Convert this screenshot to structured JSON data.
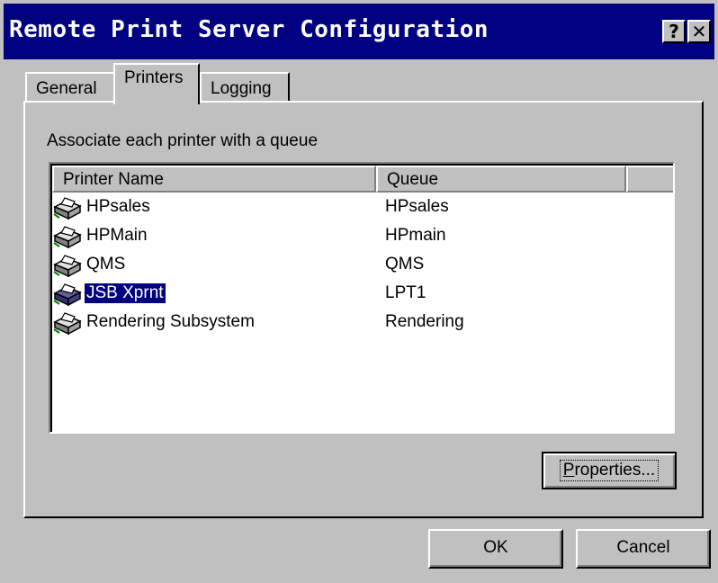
{
  "window": {
    "title": "Remote Print Server Configuration",
    "help_glyph": "?",
    "close_glyph": "✕"
  },
  "tabs": [
    {
      "label": "General",
      "active": false
    },
    {
      "label": "Printers",
      "active": true
    },
    {
      "label": "Logging",
      "active": false
    }
  ],
  "panel": {
    "description": "Associate each printer with a queue",
    "columns": [
      "Printer Name",
      "Queue"
    ],
    "rows": [
      {
        "name": "HPsales",
        "queue": "HPsales",
        "icon": "printer-icon",
        "selected": false
      },
      {
        "name": "HPMain",
        "queue": "HPmain",
        "icon": "printer-icon",
        "selected": false
      },
      {
        "name": "QMS",
        "queue": "QMS",
        "icon": "printer-icon",
        "selected": false
      },
      {
        "name": "JSB Xprnt",
        "queue": "LPT1",
        "icon": "printer-icon",
        "selected": true
      },
      {
        "name": "Rendering Subsystem",
        "queue": "Rendering",
        "icon": "printer-icon",
        "selected": false
      }
    ],
    "properties_label_mnemonic": "P",
    "properties_label_rest": "roperties..."
  },
  "buttons": {
    "ok": "OK",
    "cancel": "Cancel"
  },
  "colors": {
    "titlebar": "#000080",
    "face": "#c0c0c0",
    "selection": "#000080"
  }
}
